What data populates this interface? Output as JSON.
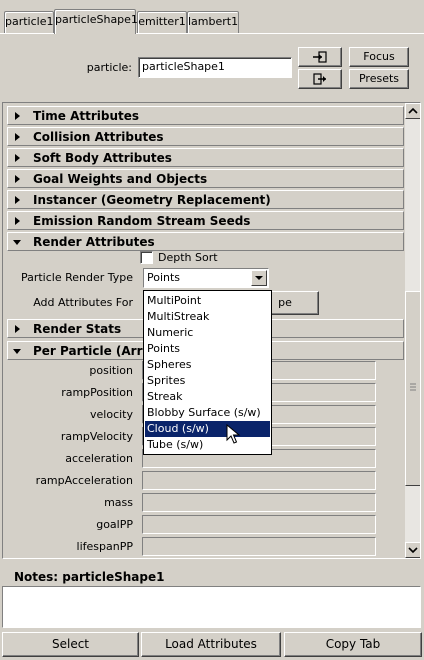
{
  "tabs": [
    {
      "label": "particle1"
    },
    {
      "label": "particleShape1",
      "active": true
    },
    {
      "label": "emitter1"
    },
    {
      "label": "lambert1"
    }
  ],
  "header": {
    "particle_label": "particle:",
    "particle_value": "particleShape1",
    "focus_label": "Focus",
    "presets_label": "Presets"
  },
  "sections": {
    "time": "Time Attributes",
    "collision": "Collision Attributes",
    "softbody": "Soft Body Attributes",
    "goal": "Goal Weights and Objects",
    "instancer": "Instancer (Geometry Replacement)",
    "emission": "Emission Random Stream Seeds",
    "render": "Render Attributes",
    "render_stats": "Render Stats",
    "per_particle": "Per Particle (Array)"
  },
  "render_attributes": {
    "depth_sort_label": "Depth Sort",
    "particle_render_type_label": "Particle Render Type",
    "particle_render_type_value": "Points",
    "add_attributes_label": "Add Attributes For",
    "add_attributes_button": "pe"
  },
  "dropdown": {
    "options": [
      "MultiPoint",
      "MultiStreak",
      "Numeric",
      "Points",
      "Spheres",
      "Sprites",
      "Streak",
      "Blobby Surface (s/w)",
      "Cloud (s/w)",
      "Tube (s/w)"
    ],
    "highlighted": "Cloud (s/w)"
  },
  "per_particle_fields": [
    "position",
    "rampPosition",
    "velocity",
    "rampVelocity",
    "acceleration",
    "rampAcceleration",
    "mass",
    "goalPP",
    "lifespanPP"
  ],
  "notes": {
    "label": "Notes:  particleShape1",
    "value": ""
  },
  "bottom_buttons": {
    "select": "Select",
    "load_attributes": "Load Attributes",
    "copy_tab": "Copy Tab"
  },
  "colors": {
    "background": "#d4d0c8",
    "selection": "#0a246a"
  }
}
